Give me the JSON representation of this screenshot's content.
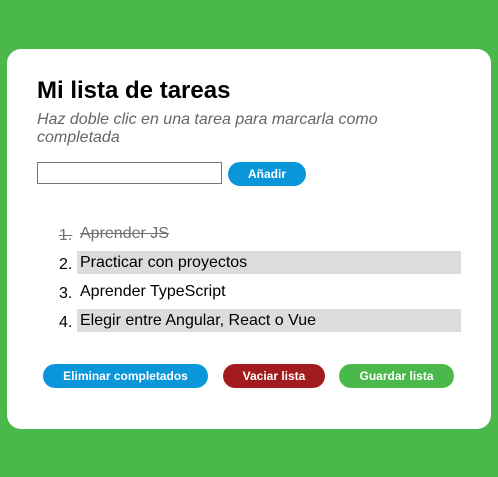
{
  "header": {
    "title": "Mi lista de tareas",
    "subtitle": "Haz doble clic en una tarea para marcarla como completada"
  },
  "form": {
    "input_value": "",
    "input_placeholder": "",
    "add_label": "Añadir"
  },
  "tasks": [
    {
      "number": "1.",
      "text": "Aprender JS",
      "completed": true
    },
    {
      "number": "2.",
      "text": "Practicar con proyectos",
      "completed": false
    },
    {
      "number": "3.",
      "text": "Aprender TypeScript",
      "completed": false
    },
    {
      "number": "4.",
      "text": "Elegir entre Angular, React o Vue",
      "completed": false
    }
  ],
  "actions": {
    "remove_completed_label": "Eliminar completados",
    "clear_list_label": "Vaciar lista",
    "save_list_label": "Guardar lista"
  },
  "colors": {
    "background": "#4bb84b",
    "primary": "#0a97d9",
    "danger": "#a21b1f",
    "success": "#4bb84b",
    "row_shade": "#dcdcdc"
  }
}
